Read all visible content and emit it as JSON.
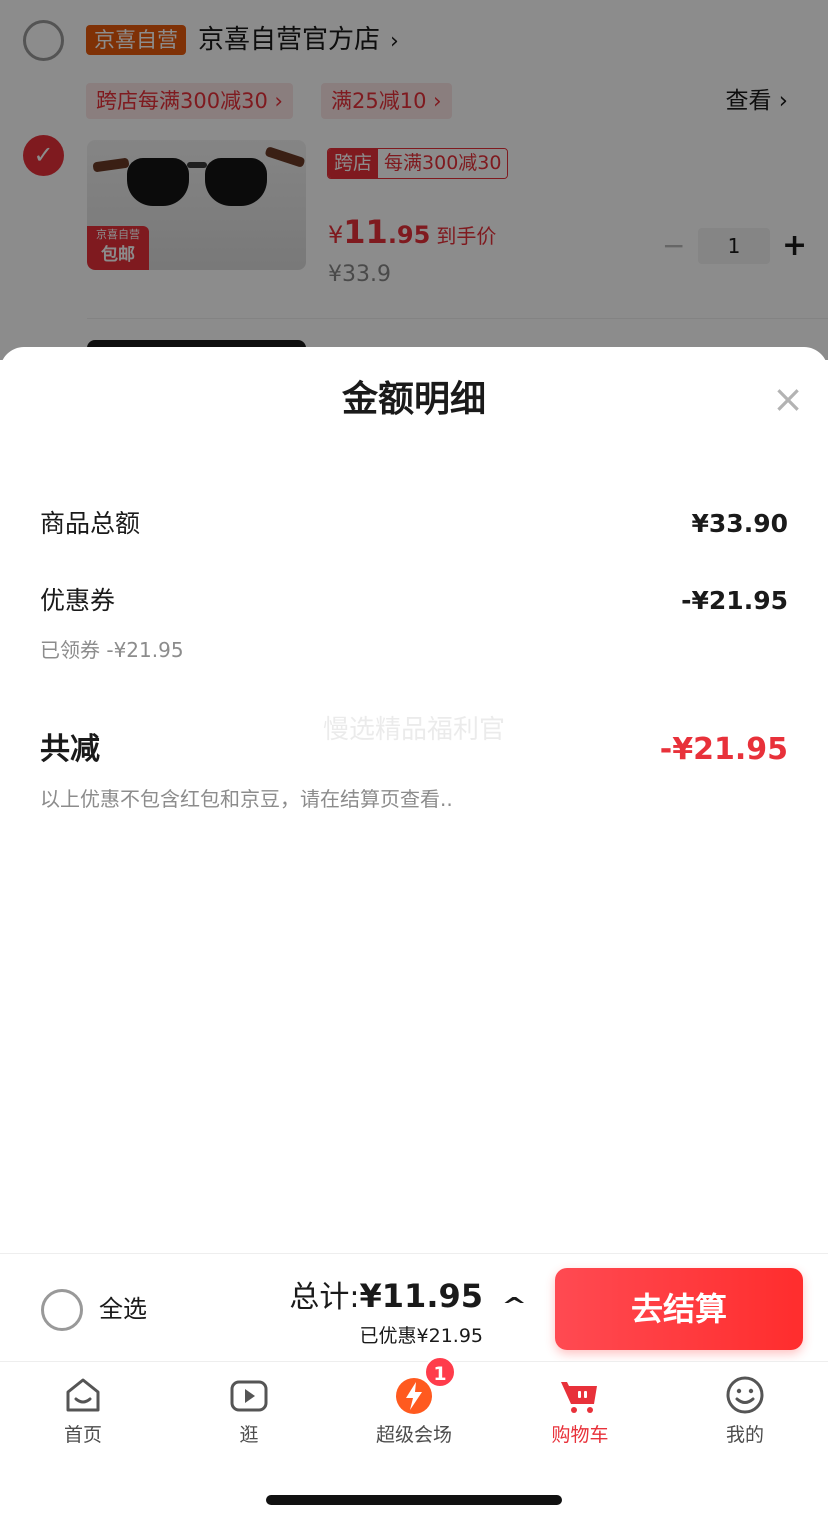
{
  "background": {
    "shop": {
      "tag": "京喜自营",
      "name": "京喜自营官方店",
      "chevron": "›"
    },
    "promos": [
      "跨店每满300减30 ›",
      "满25减10 ›"
    ],
    "view_label": "查看 ›",
    "product": {
      "checked": true,
      "ship_badge_top": "京喜自营",
      "ship_badge_bottom": "包邮",
      "cross_tag_a": "跨店",
      "cross_tag_b": "每满300减30",
      "price_yen": "¥",
      "price_int": "11",
      "price_dec": ".95",
      "price_tag": "到手价",
      "old_price": "¥33.9",
      "qty_minus": "−",
      "qty": "1",
      "qty_plus": "+"
    }
  },
  "sheet": {
    "title": "金额明细",
    "close_glyph": "×",
    "goods_total_label": "商品总额",
    "goods_total_value": "¥33.90",
    "coupon_label": "优惠券",
    "coupon_value": "-¥21.95",
    "coupon_note": "已领券 -¥21.95",
    "total_reduce_label": "共减",
    "total_reduce_value": "-¥21.95",
    "disclaimer": "以上优惠不包含红包和京豆，请在结算页查看..",
    "watermark": "慢选精品福利官"
  },
  "checkout": {
    "select_all_label": "全选",
    "total_prefix": "总计:",
    "total_amount": "¥11.95",
    "saved": "已优惠¥21.95",
    "expand_glyph": "^",
    "button_label": "去结算"
  },
  "tabbar": {
    "items": [
      {
        "label": "首页",
        "icon": "home-icon"
      },
      {
        "label": "逛",
        "icon": "play-icon"
      },
      {
        "label": "超级会场",
        "icon": "lightning-icon",
        "badge": "1"
      },
      {
        "label": "购物车",
        "icon": "cart-icon",
        "active": true
      },
      {
        "label": "我的",
        "icon": "smiley-icon"
      }
    ]
  },
  "colors": {
    "accent": "#e8313a",
    "button": "#ff3d45",
    "orange_tag": "#e8590c"
  }
}
